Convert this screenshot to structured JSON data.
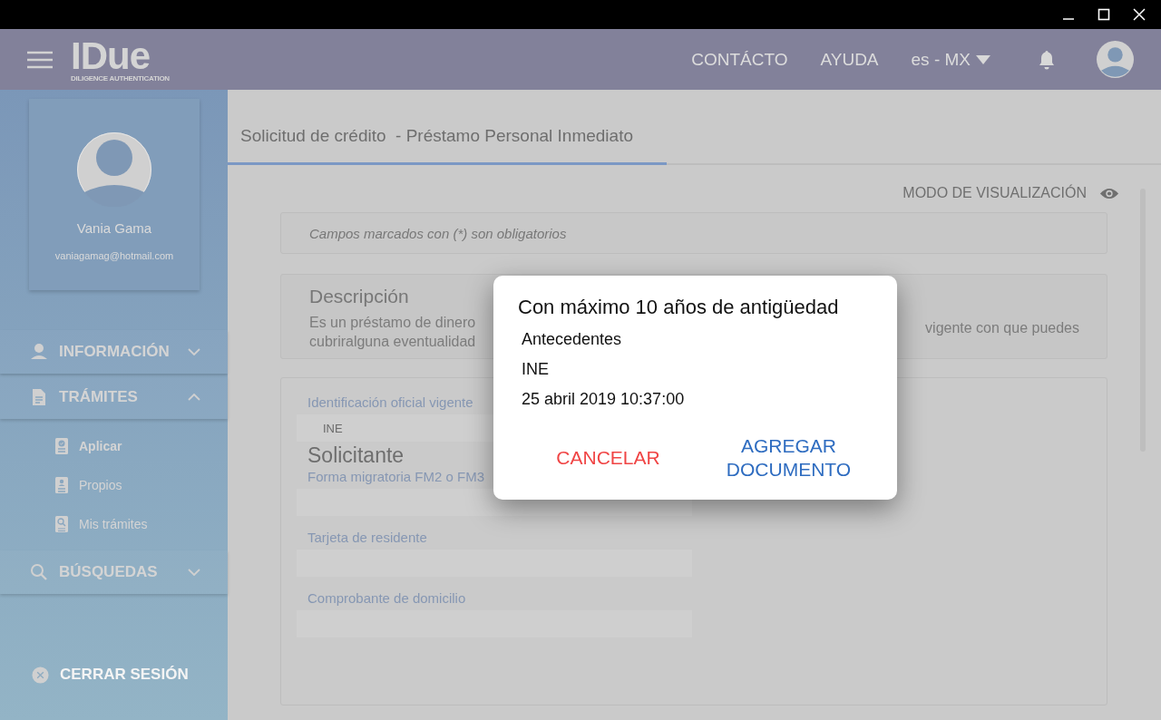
{
  "header": {
    "logo": "IDue",
    "logo_tagline": "DILIGENCE AUTHENTICATION",
    "links": [
      "CONTÁCTO",
      "AYUDA"
    ],
    "language": "es - MX"
  },
  "profile": {
    "name": "Vania Gama",
    "email": "vaniagamag@hotmail.com"
  },
  "sidebar": {
    "items": [
      {
        "label": "INFORMACIÓN",
        "expanded": false
      },
      {
        "label": "TRÁMITES",
        "expanded": true,
        "children": [
          {
            "label": "Aplicar",
            "selected": true
          },
          {
            "label": "Propios",
            "selected": false
          },
          {
            "label": "Mis trámites",
            "selected": false
          }
        ]
      },
      {
        "label": "BÚSQUEDAS",
        "expanded": false
      }
    ],
    "logout": "CERRAR SESIÓN"
  },
  "tabs": [
    {
      "label": "Solicitud de crédito  - Préstamo Personal Inmediato",
      "selected": true
    }
  ],
  "view_mode": "MODO DE VISUALIZACIÓN",
  "notice": "Campos marcados con (*) son obligatorios",
  "description": {
    "title": "Descripción",
    "text_left": [
      "Es un préstamo de dinero",
      "cubriralguna eventualidad"
    ],
    "text_right": "vigente con que puedes"
  },
  "form": [
    {
      "kind": "field",
      "label": "Identificación oficial vigente",
      "value": "INE"
    },
    {
      "kind": "heading",
      "label": "Solicitante"
    },
    {
      "kind": "field",
      "label": "Forma migratoria FM2 o FM3"
    },
    {
      "kind": "field",
      "label": "Tarjeta de residente"
    },
    {
      "kind": "field",
      "label": "Comprobante de domicilio"
    }
  ],
  "dialog": {
    "title": "Con máximo 10 años de antigüedad",
    "category": "Antecedentes",
    "document": "INE",
    "date": "25 abril 2019 10:37:00",
    "buttons": [
      {
        "label": "CANCELAR",
        "kind": "cancel"
      },
      {
        "label": "AGREGAR DOCUMENTO",
        "kind": "confirm"
      }
    ]
  }
}
